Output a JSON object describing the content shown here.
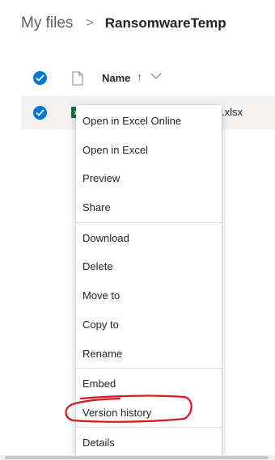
{
  "breadcrumb": {
    "root": "My files",
    "separator": ">",
    "current": "RansomwareTemp"
  },
  "list_header": {
    "name_column": "Name",
    "sort_indicator": "↑",
    "select_all_checked": true
  },
  "file_row": {
    "selected": true,
    "icon": "excel-icon",
    "icon_letter": "x",
    "visible_extension": ".xlsx"
  },
  "context_menu": {
    "groups": [
      [
        "Open in Excel Online",
        "Open in Excel",
        "Preview",
        "Share"
      ],
      [
        "Download",
        "Delete",
        "Move to",
        "Copy to",
        "Rename"
      ],
      [
        "Embed",
        "Version history"
      ],
      [
        "Details"
      ]
    ],
    "items": {
      "open_in_excel_online": "Open in Excel Online",
      "open_in_excel": "Open in Excel",
      "preview": "Preview",
      "share": "Share",
      "download": "Download",
      "delete": "Delete",
      "move_to": "Move to",
      "copy_to": "Copy to",
      "rename": "Rename",
      "embed": "Embed",
      "version_history": "Version history",
      "details": "Details"
    },
    "highlighted_item": "Version history"
  },
  "colors": {
    "accent": "#0078d4",
    "selected_row": "#f3f2f1",
    "annotation": "#e0141e",
    "excel": "#1d6f42"
  }
}
